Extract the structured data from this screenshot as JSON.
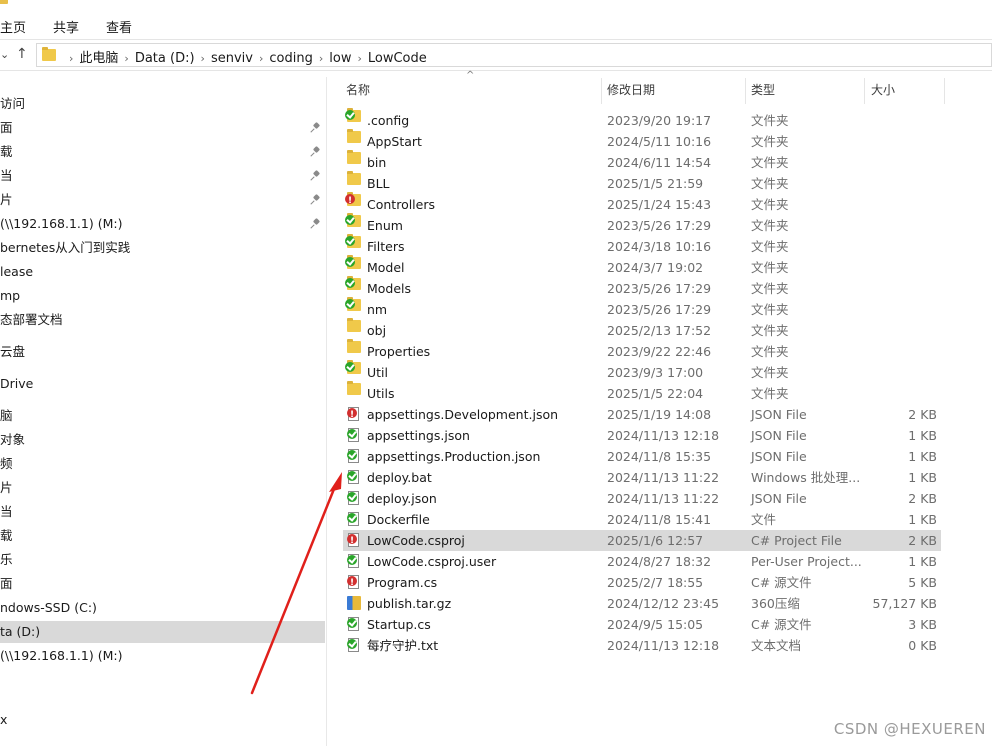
{
  "ribbon": {
    "tabs": [
      "主页",
      "共享",
      "查看"
    ]
  },
  "address": {
    "crumbs": [
      "此电脑",
      "Data (D:)",
      "senviv",
      "coding",
      "low",
      "LowCode"
    ]
  },
  "sidebar": {
    "items": [
      {
        "label": "访问",
        "pinned": false,
        "selected": false
      },
      {
        "label": "面",
        "pinned": true,
        "selected": false
      },
      {
        "label": "载",
        "pinned": true,
        "selected": false
      },
      {
        "label": "当",
        "pinned": true,
        "selected": false
      },
      {
        "label": "片",
        "pinned": true,
        "selected": false
      },
      {
        "label": "(\\\\192.168.1.1) (M:)",
        "pinned": true,
        "selected": false
      },
      {
        "label": "bernetes从入门到实践",
        "pinned": false,
        "selected": false
      },
      {
        "label": "lease",
        "pinned": false,
        "selected": false
      },
      {
        "label": "mp",
        "pinned": false,
        "selected": false
      },
      {
        "label": "态部署文档",
        "pinned": false,
        "selected": false
      },
      {
        "label": "云盘",
        "pinned": false,
        "selected": false
      },
      {
        "label": "Drive",
        "pinned": false,
        "selected": false
      },
      {
        "label": "脑",
        "pinned": false,
        "selected": false
      },
      {
        "label": "对象",
        "pinned": false,
        "selected": false
      },
      {
        "label": "频",
        "pinned": false,
        "selected": false
      },
      {
        "label": "片",
        "pinned": false,
        "selected": false
      },
      {
        "label": "当",
        "pinned": false,
        "selected": false
      },
      {
        "label": "载",
        "pinned": false,
        "selected": false
      },
      {
        "label": "乐",
        "pinned": false,
        "selected": false
      },
      {
        "label": "面",
        "pinned": false,
        "selected": false
      },
      {
        "label": "ndows-SSD (C:)",
        "pinned": false,
        "selected": false
      },
      {
        "label": "ta (D:)",
        "pinned": false,
        "selected": true
      },
      {
        "label": "(\\\\192.168.1.1) (M:)",
        "pinned": false,
        "selected": false
      },
      {
        "label": "x",
        "pinned": false,
        "selected": false
      }
    ]
  },
  "columns": {
    "name": "名称",
    "date": "修改日期",
    "type": "类型",
    "size": "大小"
  },
  "files": [
    {
      "icon": "folder",
      "badge": "ok",
      "name": ".config",
      "date": "2023/9/20 19:17",
      "type": "文件夹",
      "size": ""
    },
    {
      "icon": "folder",
      "badge": "",
      "name": "AppStart",
      "date": "2024/5/11 10:16",
      "type": "文件夹",
      "size": ""
    },
    {
      "icon": "folder",
      "badge": "",
      "name": "bin",
      "date": "2024/6/11 14:54",
      "type": "文件夹",
      "size": ""
    },
    {
      "icon": "folder",
      "badge": "",
      "name": "BLL",
      "date": "2025/1/5 21:59",
      "type": "文件夹",
      "size": ""
    },
    {
      "icon": "folder",
      "badge": "err",
      "name": "Controllers",
      "date": "2025/1/24 15:43",
      "type": "文件夹",
      "size": ""
    },
    {
      "icon": "folder",
      "badge": "ok",
      "name": "Enum",
      "date": "2023/5/26 17:29",
      "type": "文件夹",
      "size": ""
    },
    {
      "icon": "folder",
      "badge": "ok",
      "name": "Filters",
      "date": "2024/3/18 10:16",
      "type": "文件夹",
      "size": ""
    },
    {
      "icon": "folder",
      "badge": "ok",
      "name": "Model",
      "date": "2024/3/7 19:02",
      "type": "文件夹",
      "size": ""
    },
    {
      "icon": "folder",
      "badge": "ok",
      "name": "Models",
      "date": "2023/5/26 17:29",
      "type": "文件夹",
      "size": ""
    },
    {
      "icon": "folder",
      "badge": "ok",
      "name": "nm",
      "date": "2023/5/26 17:29",
      "type": "文件夹",
      "size": ""
    },
    {
      "icon": "folder",
      "badge": "",
      "name": "obj",
      "date": "2025/2/13 17:52",
      "type": "文件夹",
      "size": ""
    },
    {
      "icon": "folder",
      "badge": "",
      "name": "Properties",
      "date": "2023/9/22 22:46",
      "type": "文件夹",
      "size": ""
    },
    {
      "icon": "folder",
      "badge": "ok",
      "name": "Util",
      "date": "2023/9/3 17:00",
      "type": "文件夹",
      "size": ""
    },
    {
      "icon": "folder",
      "badge": "",
      "name": "Utils",
      "date": "2025/1/5 22:04",
      "type": "文件夹",
      "size": ""
    },
    {
      "icon": "doc",
      "badge": "err",
      "name": "appsettings.Development.json",
      "date": "2025/1/19 14:08",
      "type": "JSON File",
      "size": "2 KB"
    },
    {
      "icon": "doc",
      "badge": "ok",
      "name": "appsettings.json",
      "date": "2024/11/13 12:18",
      "type": "JSON File",
      "size": "1 KB"
    },
    {
      "icon": "doc",
      "badge": "ok",
      "name": "appsettings.Production.json",
      "date": "2024/11/8 15:35",
      "type": "JSON File",
      "size": "1 KB"
    },
    {
      "icon": "doc",
      "badge": "ok",
      "name": "deploy.bat",
      "date": "2024/11/13 11:22",
      "type": "Windows 批处理...",
      "size": "1 KB"
    },
    {
      "icon": "doc",
      "badge": "ok",
      "name": "deploy.json",
      "date": "2024/11/13 11:22",
      "type": "JSON File",
      "size": "2 KB"
    },
    {
      "icon": "doc",
      "badge": "ok",
      "name": "Dockerfile",
      "date": "2024/11/8 15:41",
      "type": "文件",
      "size": "1 KB"
    },
    {
      "icon": "doc",
      "badge": "err",
      "name": "LowCode.csproj",
      "date": "2025/1/6 12:57",
      "type": "C# Project File",
      "size": "2 KB",
      "selected": true
    },
    {
      "icon": "doc",
      "badge": "ok",
      "name": "LowCode.csproj.user",
      "date": "2024/8/27 18:32",
      "type": "Per-User Project...",
      "size": "1 KB"
    },
    {
      "icon": "doc",
      "badge": "err",
      "name": "Program.cs",
      "date": "2025/2/7 18:55",
      "type": "C# 源文件",
      "size": "5 KB"
    },
    {
      "icon": "archive",
      "badge": "",
      "name": "publish.tar.gz",
      "date": "2024/12/12 23:45",
      "type": "360压缩",
      "size": "57,127 KB"
    },
    {
      "icon": "doc",
      "badge": "ok",
      "name": "Startup.cs",
      "date": "2024/9/5 15:05",
      "type": "C# 源文件",
      "size": "3 KB"
    },
    {
      "icon": "doc",
      "badge": "ok",
      "name": "每疗守护.txt",
      "date": "2024/11/13 12:18",
      "type": "文本文档",
      "size": "0 KB"
    }
  ],
  "watermark": "CSDN @HEXUEREN",
  "colors": {
    "selected_row": "#d9d9d9",
    "folder": "#f0c94a",
    "ok_badge": "#2aa52a",
    "err_badge": "#d22f2f",
    "arrow": "#e0201b"
  }
}
